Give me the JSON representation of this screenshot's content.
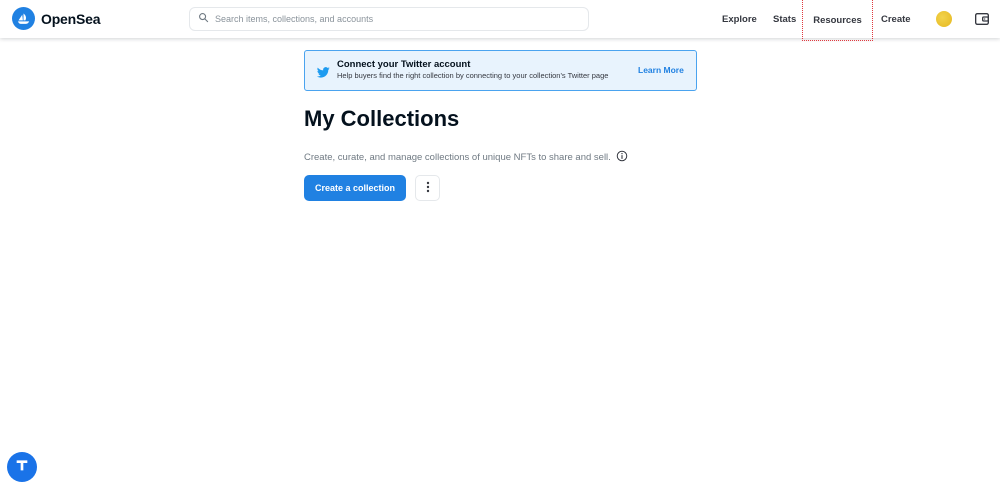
{
  "brand": {
    "name": "OpenSea"
  },
  "search": {
    "placeholder": "Search items, collections, and accounts"
  },
  "nav": {
    "explore": "Explore",
    "stats": "Stats",
    "resources": "Resources",
    "create": "Create"
  },
  "banner": {
    "title": "Connect your Twitter account",
    "description": "Help buyers find the right collection by connecting to your collection's Twitter page",
    "link": "Learn More"
  },
  "main": {
    "title": "My Collections",
    "description": "Create, curate, and manage collections of unique NFTs to share and sell.",
    "create_button": "Create a collection"
  },
  "icons": {
    "logo": "opensea-logo-icon",
    "search": "search-icon",
    "avatar": "avatar",
    "wallet": "wallet-icon",
    "twitter": "twitter-icon",
    "info": "info-icon",
    "more": "more-vertical-icon",
    "fab": "help-widget-icon"
  },
  "colors": {
    "brand_blue": "#2081e2",
    "banner_bg": "#e8f3fd",
    "banner_border": "#4aa3ef",
    "focus_outline": "#e0393e"
  }
}
